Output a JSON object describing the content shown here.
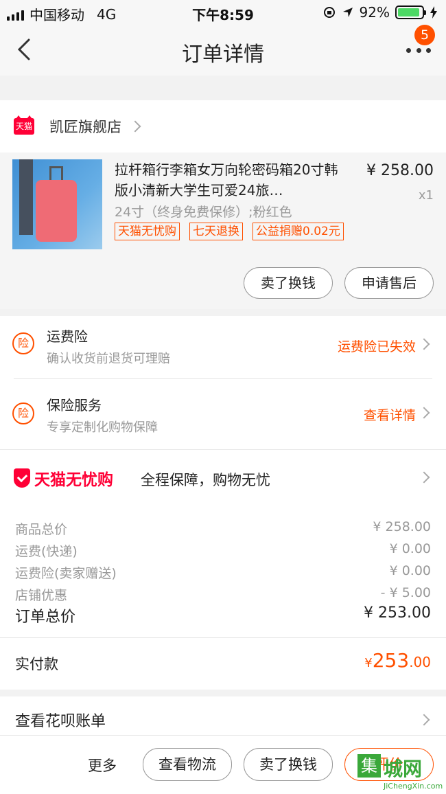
{
  "status_bar": {
    "carrier": "中国移动",
    "network": "4G",
    "time": "下午8:59",
    "battery": "92%",
    "battery_level": 0.92
  },
  "nav": {
    "title": "订单详情",
    "more_badge": "5"
  },
  "shop": {
    "name": "凯匠旗舰店",
    "logo_text": "天猫"
  },
  "product": {
    "title": "拉杆箱行李箱女万向轮密码箱20寸韩版小清新大学生可爱24旅…",
    "price": "¥ 258.00",
    "quantity": "x1",
    "sku": "24寸（终身免费保修）;粉红色",
    "tags": [
      "天猫无忧购",
      "七天退换",
      "公益捐赠0.02元"
    ],
    "actions": [
      "卖了换钱",
      "申请售后"
    ]
  },
  "services": [
    {
      "icon": "险",
      "title": "运费险",
      "subtitle": "确认收货前退货可理赔",
      "status": "运费险已失效"
    },
    {
      "icon": "险",
      "title": "保险服务",
      "subtitle": "专享定制化购物保障",
      "status": "查看详情"
    }
  ],
  "worry_free": {
    "logo_text": "天猫无忧购",
    "slogan": "全程保障，购物无忧"
  },
  "costs": {
    "rows": [
      {
        "label": "商品总价",
        "value": "¥ 258.00"
      },
      {
        "label": "运费(快递)",
        "value": "¥ 0.00"
      },
      {
        "label": "运费险(卖家赠送)",
        "value": "¥ 0.00"
      },
      {
        "label": "店铺优惠",
        "value": "- ¥ 5.00"
      }
    ],
    "total_label": "订单总价",
    "total_value": "¥ 253.00"
  },
  "paid": {
    "label": "实付款",
    "currency": "¥",
    "integer": "253",
    "decimal": ".00"
  },
  "huabei": {
    "label": "查看花呗账单"
  },
  "bottom_bar": {
    "more": "更多",
    "buttons": [
      "查看物流",
      "卖了换钱",
      "评价"
    ]
  },
  "watermark": {
    "box": "集",
    "text": "城网",
    "sub": "JiChengXin.com"
  },
  "colors": {
    "accent": "#ff5000",
    "tmall_red": "#ff0036",
    "battery_green": "#4cd964"
  }
}
